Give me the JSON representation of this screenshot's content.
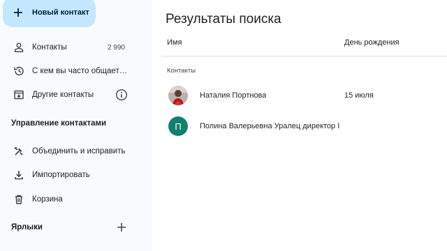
{
  "sidebar": {
    "new_contact_label": "Новый контакт",
    "items": [
      {
        "label": "Контакты",
        "count": "2 990",
        "icon": "person-icon"
      },
      {
        "label": "С кем вы часто общает…",
        "icon": "history-icon"
      },
      {
        "label": "Другие контакты",
        "icon": "archive-download-icon",
        "info_icon": "info-icon"
      }
    ],
    "manage_title": "Управление контактами",
    "manage_items": [
      {
        "label": "Объединить и исправить",
        "icon": "tools-icon"
      },
      {
        "label": "Импортировать",
        "icon": "download-icon"
      },
      {
        "label": "Корзина",
        "icon": "trash-icon"
      }
    ],
    "labels_title": "Ярлыки"
  },
  "main": {
    "title": "Результаты поиска",
    "columns": {
      "name": "Имя",
      "birthday": "День рождения"
    },
    "group_label": "Контакты",
    "rows": [
      {
        "name": "Наталия Портнова",
        "birthday": "15 июля",
        "avatar": "photo"
      },
      {
        "name": "Полина Валерьевна Уралец директор I",
        "birthday": "",
        "avatar_letter": "П",
        "avatar_color": "#12806e"
      }
    ]
  },
  "colors": {
    "sidebar_bg": "#f8fafd",
    "new_contact_bg": "#c2e7ff",
    "accent_teal": "#12806e"
  }
}
